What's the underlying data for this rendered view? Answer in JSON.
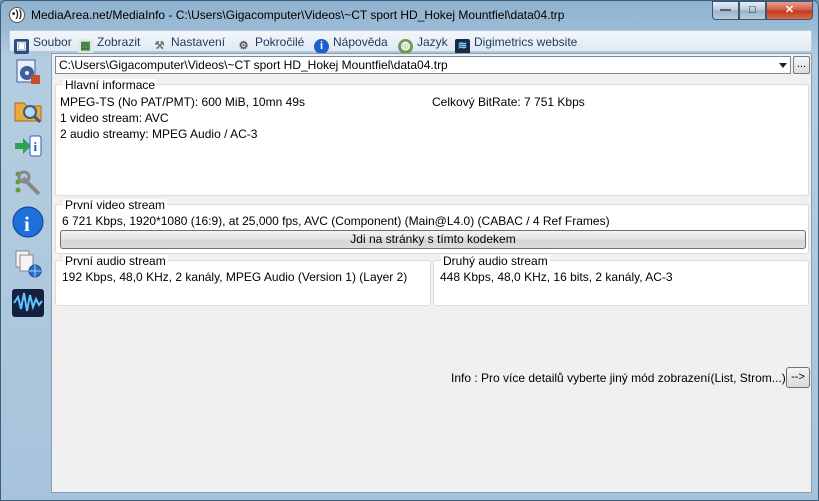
{
  "window": {
    "title": "MediaArea.net/MediaInfo - C:\\Users\\Gigacomputer\\Videos\\~CT sport HD_Hokej Mountfiel\\data04.trp",
    "app_icon_glyph": "•))",
    "controls": {
      "minimize": "—",
      "maximize": "□",
      "close": "✕"
    }
  },
  "menu": {
    "items": [
      {
        "label": "Soubor",
        "icon": "file-icon",
        "color": "#2a4f87"
      },
      {
        "label": "Zobrazit",
        "icon": "view-icon",
        "color": "#3a7a3a"
      },
      {
        "label": "Nastavení",
        "icon": "settings-icon",
        "color": "#667766"
      },
      {
        "label": "Pokročilé",
        "icon": "advanced-icon",
        "color": "#555555"
      },
      {
        "label": "Nápověda",
        "icon": "help-icon",
        "color": "#1f5fc8"
      },
      {
        "label": "Jazyk",
        "icon": "language-icon",
        "color": "#4a7a3a"
      },
      {
        "label": "Digimetrics website",
        "icon": "digimetrics-icon",
        "color": "#1b2a48"
      }
    ]
  },
  "sidebar": {
    "buttons": [
      {
        "icon": "open-file-icon"
      },
      {
        "icon": "open-folder-icon"
      },
      {
        "icon": "export-icon"
      },
      {
        "icon": "preferences-icon"
      },
      {
        "icon": "about-icon"
      },
      {
        "icon": "web-icon"
      },
      {
        "icon": "digimetrics-logo-icon"
      }
    ]
  },
  "file_selector": {
    "value": "C:\\Users\\Gigacomputer\\Videos\\~CT sport HD_Hokej Mountfiel\\data04.trp",
    "browse_label": "..."
  },
  "main_info": {
    "title": "Hlavní informace",
    "format": "MPEG-TS (No PAT/PMT): 600 MiB, 10mn 49s",
    "bitrate": "Celkový BitRate: 7 751 Kbps",
    "video_count": "1 video stream: AVC",
    "audio_count": "2 audio streamy: MPEG Audio / AC-3"
  },
  "video_stream": {
    "title": "První video stream",
    "details": "6 721 Kbps, 1920*1080 (16:9), at 25,000 fps, AVC (Component) (Main@L4.0) (CABAC / 4 Ref Frames)",
    "codec_button": "Jdi na stránky s tímto kodekem"
  },
  "audio_stream_1": {
    "title": "První audio stream",
    "details": "192 Kbps, 48,0 KHz, 2 kanály, MPEG Audio (Version 1) (Layer 2)"
  },
  "audio_stream_2": {
    "title": "Druhý audio stream",
    "details": "448 Kbps, 48,0 KHz, 16 bits, 2 kanály, AC-3"
  },
  "footer": {
    "info": "Info : Pro více detailů vyberte jiný mód zobrazení(List, Strom...)",
    "arrow_label": "-->"
  }
}
